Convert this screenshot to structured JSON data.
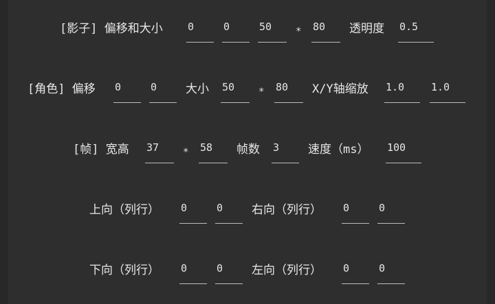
{
  "shadow": {
    "label": "[影子] 偏移和大小",
    "offset_x": "0",
    "offset_y": "0",
    "width": "50",
    "times": "*",
    "height": "80",
    "opacity_label": "透明度",
    "opacity": "0.5"
  },
  "character": {
    "label": "[角色] 偏移",
    "offset_x": "0",
    "offset_y": "0",
    "size_label": "大小",
    "width": "50",
    "times": "*",
    "height": "80",
    "scale_label": "X/Y轴缩放",
    "scale_x": "1.0",
    "scale_y": "1.0"
  },
  "frame": {
    "label": "[帧] 宽高",
    "width": "37",
    "times": "*",
    "height": "58",
    "count_label": "帧数",
    "count": "3",
    "speed_label": "速度（ms）",
    "speed": "100"
  },
  "directions": {
    "up_label": "上向（列行）",
    "up_col": "0",
    "up_row": "0",
    "right_label": "右向（列行）",
    "right_col": "0",
    "right_row": "0",
    "down_label": "下向（列行）",
    "down_col": "0",
    "down_row": "0",
    "left_label": "左向（列行）",
    "left_col": "0",
    "left_row": "0"
  }
}
